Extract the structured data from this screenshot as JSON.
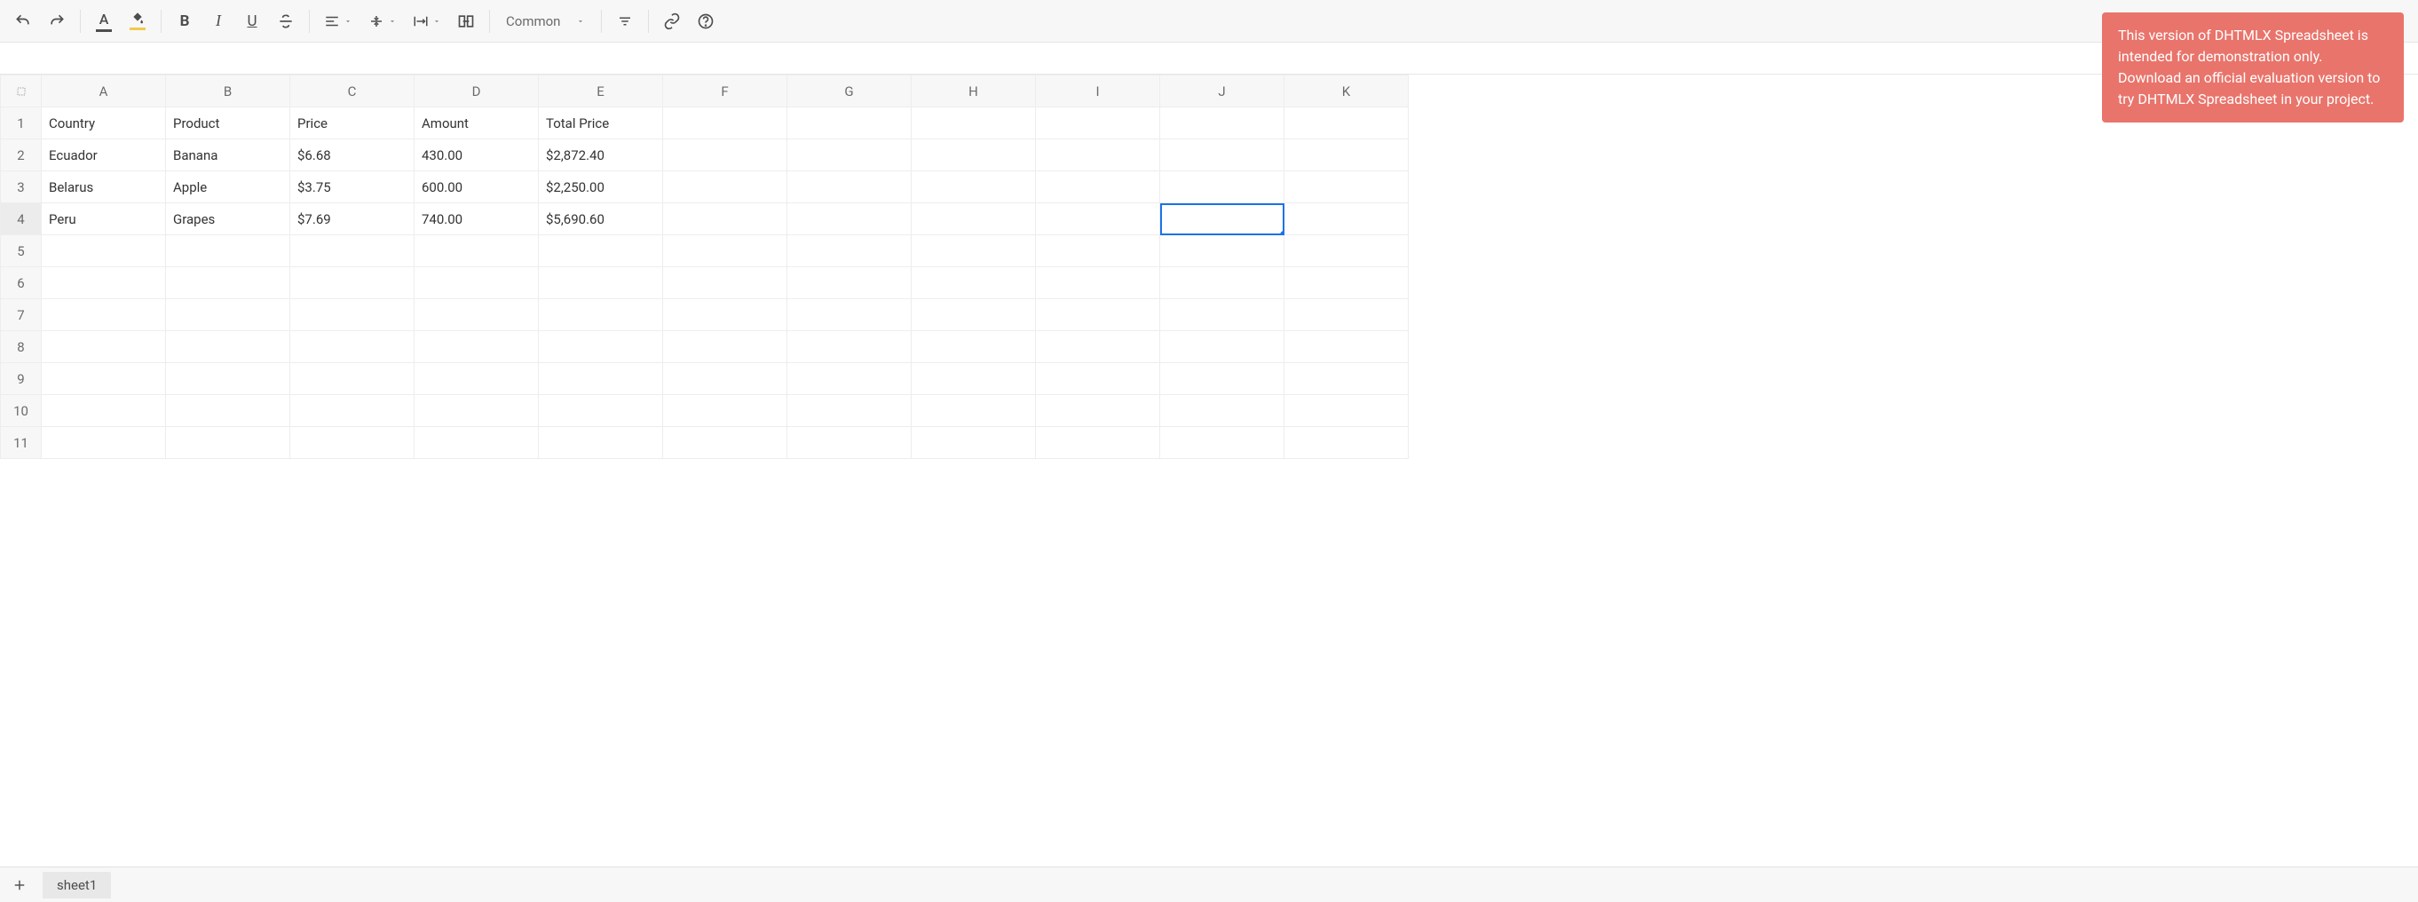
{
  "toolbar": {
    "font_color": "#4d4d4d",
    "bg_color": "#f2c94c",
    "format_label": "Common"
  },
  "grid": {
    "columns": [
      "A",
      "B",
      "C",
      "D",
      "E",
      "F",
      "G",
      "H",
      "I",
      "J",
      "K"
    ],
    "headers": [
      "Country",
      "Product",
      "Price",
      "Amount",
      "Total Price"
    ],
    "rows": [
      {
        "country": "Ecuador",
        "product": "Banana",
        "price": "$6.68",
        "amount": "430.00",
        "total": "$2,872.40"
      },
      {
        "country": "Belarus",
        "product": "Apple",
        "price": "$3.75",
        "amount": "600.00",
        "total": "$2,250.00"
      },
      {
        "country": "Peru",
        "product": "Grapes",
        "price": "$7.69",
        "amount": "740.00",
        "total": "$5,690.60"
      }
    ],
    "total_rows": 11,
    "selected_cell": {
      "row": 4,
      "col": 10
    }
  },
  "tabs": {
    "sheets": [
      "sheet1"
    ]
  },
  "notice": {
    "text": "This version of DHTMLX Spreadsheet is intended for demonstration only. Download an official evaluation version to try DHTMLX Spreadsheet in your project."
  }
}
